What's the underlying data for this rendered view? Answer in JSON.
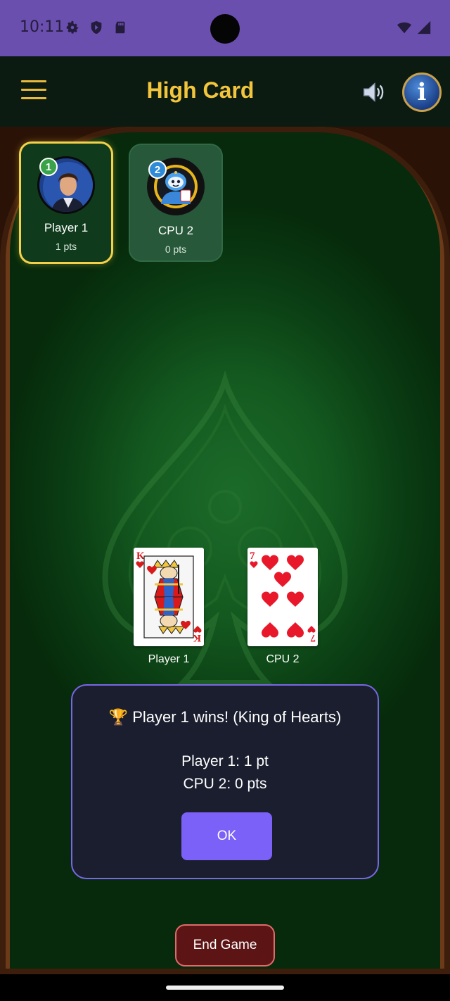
{
  "status_bar": {
    "time": "10:11",
    "icons": [
      "gear-icon",
      "shield-icon",
      "sd-card-icon",
      "wifi-icon",
      "signal-icon"
    ]
  },
  "app_bar": {
    "title": "High Card",
    "menu_icon": "hamburger-menu-icon",
    "sound_icon": "speaker-icon",
    "info_icon": "info-icon",
    "title_color": "#f2c53d"
  },
  "players": [
    {
      "badge": "1",
      "name": "Player 1",
      "points": "1 pts",
      "active": true
    },
    {
      "badge": "2",
      "name": "CPU 2",
      "points": "0 pts",
      "active": false
    }
  ],
  "played_cards": [
    {
      "rank": "K",
      "suit": "hearts",
      "owner": "Player 1"
    },
    {
      "rank": "7",
      "suit": "hearts",
      "owner": "CPU 2"
    }
  ],
  "result": {
    "trophy": "🏆",
    "message": "Player 1 wins!  (King of Hearts)",
    "score_lines": [
      "Player 1: 1 pt",
      "CPU 2: 0 pts"
    ],
    "ok_label": "OK"
  },
  "end_game_label": "End Game",
  "colors": {
    "accent": "#7b61f8",
    "active_border": "#f3d24a",
    "felt": "#145a20",
    "status_bar": "#6a4fae"
  }
}
